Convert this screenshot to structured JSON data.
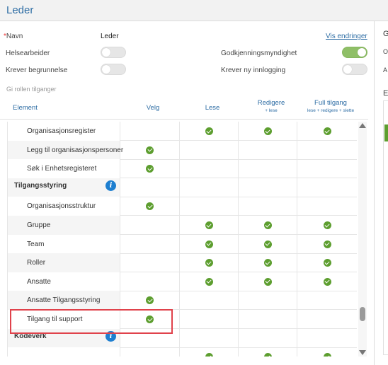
{
  "header": {
    "title": "Leder"
  },
  "form": {
    "name_label": "Navn",
    "name_required_mark": "*",
    "name_value": "Leder",
    "vis_endringer_link": "Vis endringer",
    "helsearbeider_label": "Helsearbeider",
    "helsearbeider_on": false,
    "godkjenning_label": "Godkjenningsmyndighet",
    "godkjenning_on": true,
    "krever_begrunnelse_label": "Krever begrunnelse",
    "krever_begrunnelse_on": false,
    "krever_ny_innlogging_label": "Krever ny innlogging",
    "krever_ny_innlogging_on": false
  },
  "section_hint": "Gi rollen tilganger",
  "table": {
    "columns": {
      "element": "Element",
      "velg": "Velg",
      "lese": "Lese",
      "redigere": "Redigere",
      "redigere_sub": "+ lese",
      "full": "Full tilgang",
      "full_sub": "lese + redigere + slette"
    },
    "rows": [
      {
        "label": "Organisasjonsregister",
        "type": "item",
        "alt": false,
        "velg": false,
        "lese": true,
        "redigere": true,
        "full": true
      },
      {
        "label": "Legg til organisasjonspersoner",
        "type": "item",
        "alt": true,
        "velg": true,
        "lese": false,
        "redigere": false,
        "full": false
      },
      {
        "label": "Søk i Enhetsregisteret",
        "type": "item",
        "alt": false,
        "velg": true,
        "lese": false,
        "redigere": false,
        "full": false
      },
      {
        "label": "Tilgangsstyring",
        "type": "section",
        "alt": false,
        "velg": false,
        "lese": false,
        "redigere": false,
        "full": false
      },
      {
        "label": "Organisasjonsstruktur",
        "type": "item",
        "alt": false,
        "velg": true,
        "lese": false,
        "redigere": false,
        "full": false
      },
      {
        "label": "Gruppe",
        "type": "item",
        "alt": true,
        "velg": false,
        "lese": true,
        "redigere": true,
        "full": true
      },
      {
        "label": "Team",
        "type": "item",
        "alt": false,
        "velg": false,
        "lese": true,
        "redigere": true,
        "full": true
      },
      {
        "label": "Roller",
        "type": "item",
        "alt": true,
        "velg": false,
        "lese": true,
        "redigere": true,
        "full": true
      },
      {
        "label": "Ansatte",
        "type": "item",
        "alt": false,
        "velg": false,
        "lese": true,
        "redigere": true,
        "full": true
      },
      {
        "label": "Ansatte Tilgangsstyring",
        "type": "item",
        "alt": true,
        "velg": true,
        "lese": false,
        "redigere": false,
        "full": false
      },
      {
        "label": "Tilgang til support",
        "type": "item",
        "alt": false,
        "velg": true,
        "lese": false,
        "redigere": false,
        "full": false
      },
      {
        "label": "Kodeverk",
        "type": "section",
        "alt": false,
        "velg": false,
        "lese": false,
        "redigere": false,
        "full": false
      },
      {
        "label": "",
        "type": "item",
        "alt": false,
        "velg": false,
        "lese": true,
        "redigere": true,
        "full": true
      }
    ]
  },
  "right_panel": {
    "heading": "G",
    "label_1": "O",
    "label_2": "A",
    "label_3": "E"
  },
  "colors": {
    "accent": "#2f6ea5",
    "check_green": "#5d9e2f",
    "toggle_on": "#8fbf67",
    "highlight": "#e0424b",
    "info_blue": "#1e7fd0"
  },
  "icons": {
    "check": "check-circle-icon",
    "info": "info-icon",
    "scroll_up": "arrow-up-icon",
    "scroll_down": "arrow-down-icon"
  }
}
